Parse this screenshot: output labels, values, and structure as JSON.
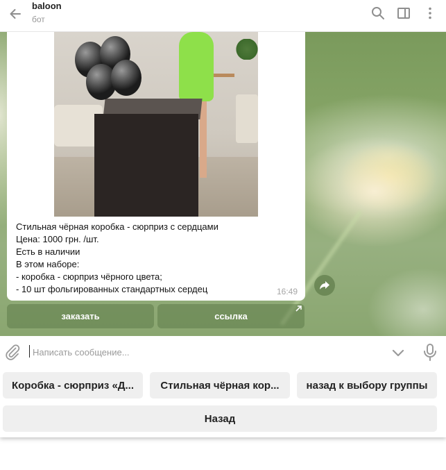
{
  "header": {
    "title": "baloon",
    "subtitle": "бот",
    "icons": [
      "back-arrow-icon",
      "search-icon",
      "sidebar-icon",
      "more-vertical-icon"
    ]
  },
  "message": {
    "text": "Стильная чёрная коробка - сюрприз с сердцами\nЦена: 1000 грн. /шт.\nЕсть в наличии\nВ этом наборе:\n- коробка - сюрприз чёрного цвета;\n- 10 шт фольгированных стандартных сердец",
    "time": "16:49"
  },
  "inline_buttons": [
    {
      "label": "заказать"
    },
    {
      "label": "ссылка",
      "icon": "external-link-icon"
    }
  ],
  "composer": {
    "placeholder": "Написать сообщение..."
  },
  "reply_keyboard": {
    "row1": [
      "Коробка - сюрприз «Д...",
      "Стильная чёрная кор...",
      "назад к выбору группы"
    ],
    "row2": [
      "Назад"
    ]
  },
  "colors": {
    "accent": "#5a7846",
    "icon_gray": "#9a9a9a"
  }
}
